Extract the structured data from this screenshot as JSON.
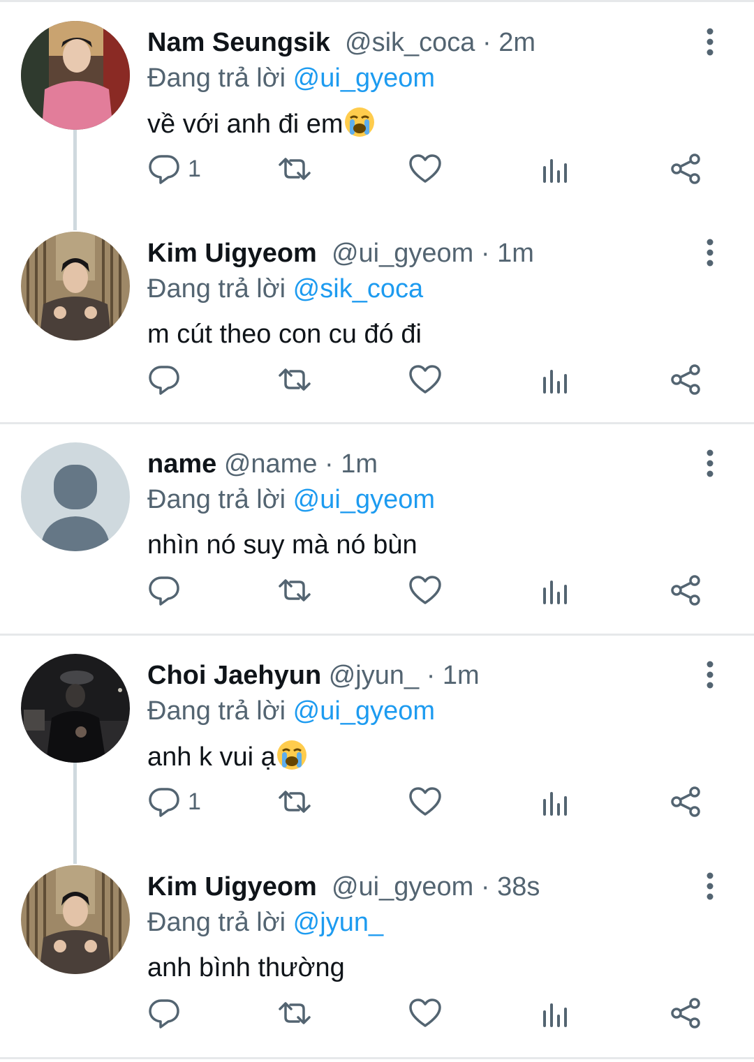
{
  "reply_prefix": "Đang trả lời",
  "tweets": [
    {
      "name": "Nam Seungsik",
      "handle": "@sik_coca",
      "time": "2m",
      "reply_to": "@ui_gyeom",
      "text": "về với anh đi em",
      "emoji": "loudly-crying-face",
      "reply_count": "1",
      "avatar": "photo-pink-sweater"
    },
    {
      "name": "Kim Uigyeom",
      "handle": "@ui_gyeom",
      "time": "1m",
      "reply_to": "@sik_coca",
      "text": "m cút theo con cu đó đi",
      "emoji": "",
      "reply_count": "",
      "avatar": "photo-brown-jacket"
    },
    {
      "name": "name",
      "handle": "@name",
      "time": "1m",
      "reply_to": "@ui_gyeom",
      "text": "nhìn nó suy mà nó bùn",
      "emoji": "",
      "reply_count": "",
      "avatar": "default-profile"
    },
    {
      "name": "Choi Jaehyun",
      "handle": "@jyun_",
      "time": "1m",
      "reply_to": "@ui_gyeom",
      "text": "anh k vui ạ",
      "emoji": "loudly-crying-face",
      "reply_count": "1",
      "avatar": "photo-dark-night"
    },
    {
      "name": "Kim Uigyeom",
      "handle": "@ui_gyeom",
      "time": "38s",
      "reply_to": "@jyun_",
      "text": "anh bình thường",
      "emoji": "",
      "reply_count": "",
      "avatar": "photo-brown-jacket"
    }
  ],
  "icons": [
    "reply-icon",
    "retweet-icon",
    "like-icon",
    "views-icon",
    "share-icon",
    "more-icon"
  ],
  "colors": {
    "text": "#0f1419",
    "secondary": "#536471",
    "mention": "#1d9bf0",
    "thread_line": "#cfd9de",
    "separator": "#e6e8ea"
  }
}
